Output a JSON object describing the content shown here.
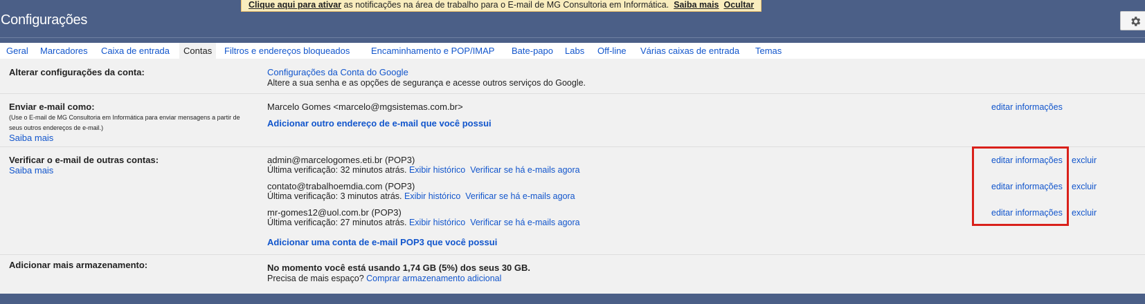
{
  "banner": {
    "activate_link": "Clique aqui para ativar",
    "message": " as notificações na área de trabalho para o E-mail de MG Consultoria em Informática.",
    "learn_more": "Saiba mais",
    "hide": "Ocultar"
  },
  "header": {
    "title": "Configurações",
    "settings_icon": "gear-icon"
  },
  "tabs": [
    {
      "label": "Geral"
    },
    {
      "label": "Marcadores"
    },
    {
      "label": "Caixa de entrada"
    },
    {
      "label": "Contas",
      "active": true
    },
    {
      "label": "Filtros e endereços bloqueados"
    },
    {
      "label": "Encaminhamento e POP/IMAP"
    },
    {
      "label": "Bate-papo"
    },
    {
      "label": "Labs"
    },
    {
      "label": "Off-line"
    },
    {
      "label": "Várias caixas de entrada"
    },
    {
      "label": "Temas"
    }
  ],
  "sections": {
    "account": {
      "label": "Alterar configurações da conta:",
      "link": "Configurações da Conta do Google",
      "desc": "Altere a sua senha e as opções de segurança e acesse outros serviços do Google."
    },
    "send_as": {
      "label": "Enviar e-mail como:",
      "note": "(Use o E-mail de MG Consultoria em Informática para enviar mensagens a partir de seus outros endereços de e-mail.)",
      "learn_more": "Saiba mais",
      "identity": "Marcelo Gomes <marcelo@mgsistemas.com.br>",
      "edit": "editar informações",
      "add": "Adicionar outro endereço de e-mail que você possui"
    },
    "check_mail": {
      "label": "Verificar o e-mail de outras contas:",
      "learn_more": "Saiba mais",
      "accounts": [
        {
          "address": "admin@marcelogomes.eti.br (POP3)",
          "last_check": "Última verificação: 32 minutos atrás.",
          "history": "Exibir histórico",
          "check_now": "Verificar se há e-mails agora",
          "edit": "editar informações",
          "delete": "excluir"
        },
        {
          "address": "contato@trabalhoemdia.com (POP3)",
          "last_check": "Última verificação: 3 minutos atrás.",
          "history": "Exibir histórico",
          "check_now": "Verificar se há e-mails agora",
          "edit": "editar informações",
          "delete": "excluir"
        },
        {
          "address": "mr-gomes12@uol.com.br (POP3)",
          "last_check": "Última verificação: 27 minutos atrás.",
          "history": "Exibir histórico",
          "check_now": "Verificar se há e-mails agora",
          "edit": "editar informações",
          "delete": "excluir"
        }
      ],
      "add": "Adicionar uma conta de e-mail POP3 que você possui"
    },
    "storage": {
      "label": "Adicionar mais armazenamento:",
      "usage": "No momento você está usando 1,74 GB (5%) dos seus 30 GB.",
      "need_more": "Precisa de mais espaço? ",
      "buy": "Comprar armazenamento adicional"
    }
  },
  "colors": {
    "header_bg": "#4b5f87",
    "link": "#1155cc",
    "highlight_border": "#d9201a",
    "banner_bg": "#f9edbe"
  }
}
